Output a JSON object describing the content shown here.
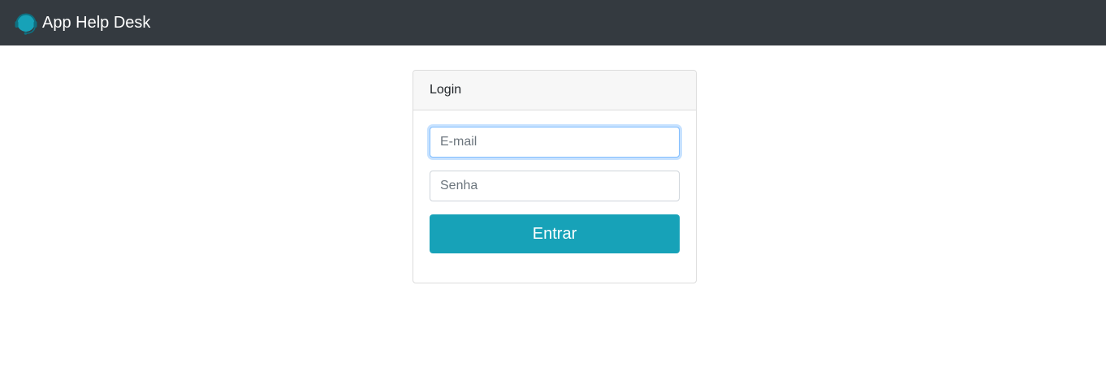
{
  "navbar": {
    "brand_text": "App Help Desk",
    "brand_icon": "headset-icon",
    "background": "#343a40",
    "icon_color": "#17a2b8"
  },
  "login_card": {
    "header": "Login",
    "email_placeholder": "E-mail",
    "email_value": "",
    "password_placeholder": "Senha",
    "password_value": "",
    "submit_label": "Entrar",
    "button_color": "#17a2b8"
  }
}
